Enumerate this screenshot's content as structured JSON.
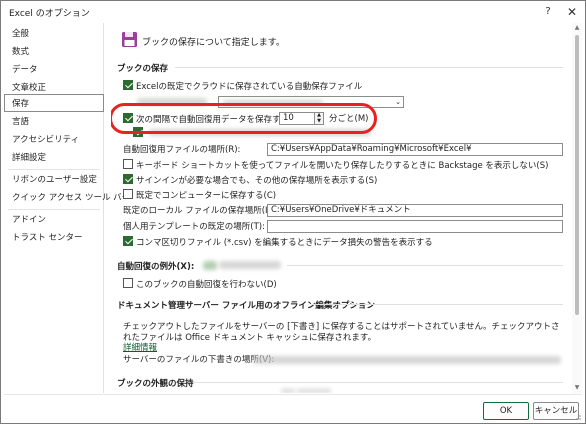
{
  "window": {
    "title": "Excel のオプション",
    "help_label": "?",
    "close_label": "✕"
  },
  "sidebar": {
    "items": [
      {
        "label": "全般"
      },
      {
        "label": "数式"
      },
      {
        "label": "データ"
      },
      {
        "label": "文章校正"
      },
      {
        "label": "保存"
      },
      {
        "label": "言語"
      },
      {
        "label": "アクセシビリティ"
      },
      {
        "label": "詳細設定"
      },
      {
        "label": "リボンのユーザー設定"
      },
      {
        "label": "クイック アクセス ツール バー"
      },
      {
        "label": "アドイン"
      },
      {
        "label": "トラスト センター"
      }
    ],
    "active_index": 4
  },
  "content": {
    "header": "ブックの保存について指定します。",
    "sections": {
      "save_workbooks": "ブックの保存",
      "autorecover_exceptions": "自動回復の例外(X):",
      "offline_editing": "ドキュメント管理サーバー ファイル用のオフライン編集オプション",
      "preserve_appearance": "ブックの外観の保持"
    },
    "options": {
      "autosave_cloud": "Excelの既定でクラウドに保存されている自動保存ファイル",
      "autorecover_interval": "次の間隔で自動回復用データを保存する(A):",
      "autorecover_value": "10",
      "autorecover_unit": "分ごと(M)",
      "autorecover_path_label": "自動回復用ファイルの場所(R):",
      "autorecover_path_value": "C:¥Users¥AppData¥Roaming¥Microsoft¥Excel¥",
      "no_backstage": "キーボード ショートカットを使ってファイルを開いたり保存したりするときに Backstage を表示しない(S)",
      "show_additional_places": "サインインが必要な場合でも、その他の保存場所を表示する(S)",
      "save_to_computer": "既定でコンピューターに保存する(C)",
      "default_local_label": "既定のローカル ファイルの保存場所(I):",
      "default_local_value": "C:¥Users¥OneDrive¥ドキュメント",
      "personal_templates_label": "個人用テンプレートの既定の場所(T):",
      "personal_templates_value": "",
      "csv_warning": "コンマ区切りファイル (*.csv) を編集するときにデータ損失の警告を表示する",
      "disable_autorecover": "このブックの自動回復を行わない(D)",
      "offline_text": "チェックアウトしたファイルをサーバーの [下書き] に保存することはサポートされていません。チェックアウトされたファイルは Office ドキュメント キャッシュに保存されます。",
      "details_link": "詳細情報",
      "server_drafts_label": "サーバーのファイルの下書きの場所(V):"
    },
    "checkbox_states": {
      "autosave_cloud": true,
      "autorecover_interval": true,
      "no_backstage": false,
      "show_additional_places": true,
      "save_to_computer": false,
      "csv_warning": true,
      "disable_autorecover": false
    }
  },
  "footer": {
    "ok_label": "OK",
    "cancel_label": "キャンセル"
  },
  "colors": {
    "accent_green": "#2d6a32",
    "highlight_red": "#e8231f",
    "icon_purple": "#9b3f9b"
  }
}
